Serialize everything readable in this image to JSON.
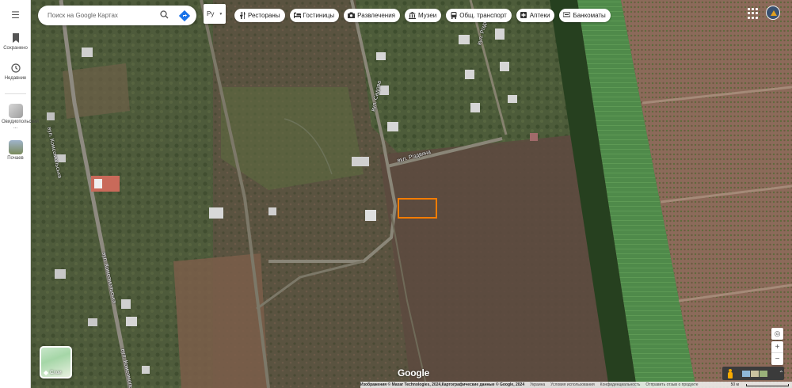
{
  "sidebar": {
    "items": [
      {
        "label": "Сохранено",
        "icon": "bookmark-icon"
      },
      {
        "label": "Недавние",
        "icon": "history-icon"
      },
      {
        "label": "Овидиопольский ...",
        "icon": "place-thumbnail"
      },
      {
        "label": "Почаев",
        "icon": "place-thumbnail"
      }
    ]
  },
  "search": {
    "placeholder": "Поиск на Google Картах",
    "search_icon": "search-icon",
    "directions_icon": "directions-icon"
  },
  "language": {
    "value": "Ру"
  },
  "chips": [
    {
      "label": "Рестораны",
      "icon": "restaurant-icon"
    },
    {
      "label": "Гостиницы",
      "icon": "hotel-icon"
    },
    {
      "label": "Развлечения",
      "icon": "camera-icon"
    },
    {
      "label": "Музеи",
      "icon": "museum-icon"
    },
    {
      "label": "Общ. транспорт",
      "icon": "transit-icon"
    },
    {
      "label": "Аптеки",
      "icon": "pharmacy-icon"
    },
    {
      "label": "Банкоматы",
      "icon": "atm-icon"
    }
  ],
  "map": {
    "roads": [
      "вул. Комсомольська",
      "вул. Комсомольська",
      "вул. Комсомольська",
      "вул. Садова",
      "вул. Різдвяна",
      "вул. Різдвяна"
    ],
    "layers_label": "Слои",
    "logo": "Google",
    "marker_color": "#f57c00"
  },
  "footer": {
    "attribution": "Изображения © Maxar Technologies, 2024,Картографические данные © Google, 2024",
    "links": [
      "Украина",
      "Условия использования",
      "Конфиденциальность",
      "Отправить отзыв о продукте"
    ],
    "scale": "50 м"
  }
}
